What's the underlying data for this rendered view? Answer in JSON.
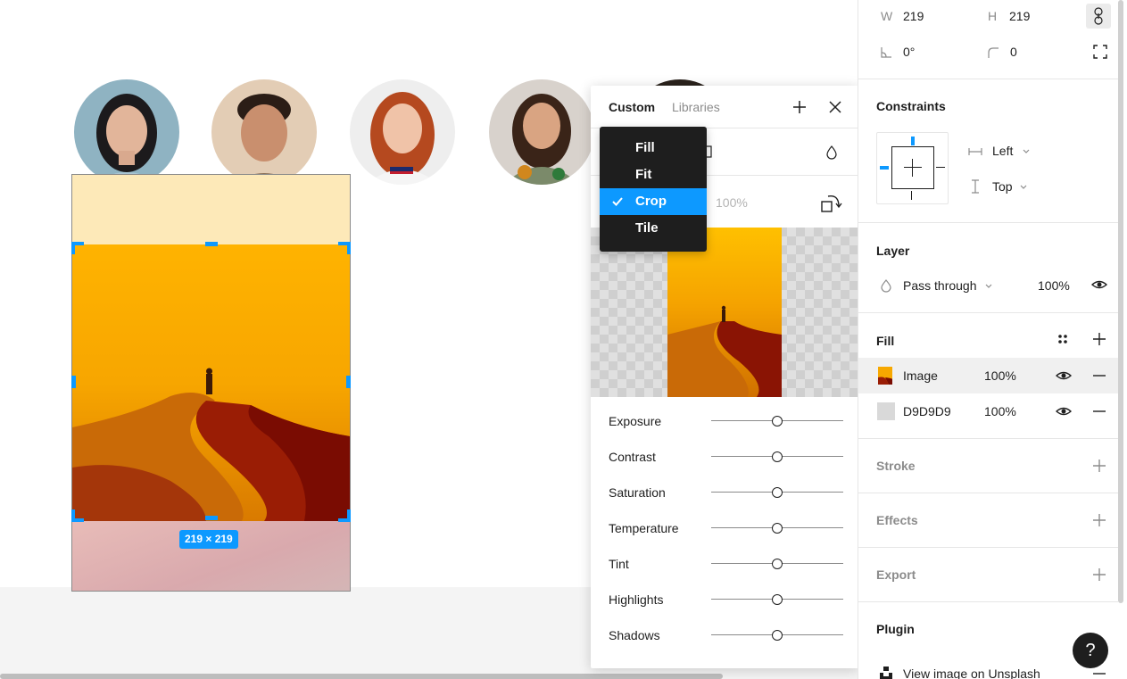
{
  "canvas": {
    "size_badge": "219 × 219"
  },
  "popup": {
    "tabs": [
      {
        "label": "Custom"
      },
      {
        "label": "Libraries"
      }
    ],
    "opacity": "100%",
    "adjustments": [
      {
        "label": "Exposure",
        "value": 0.5
      },
      {
        "label": "Contrast",
        "value": 0.5
      },
      {
        "label": "Saturation",
        "value": 0.5
      },
      {
        "label": "Temperature",
        "value": 0.5
      },
      {
        "label": "Tint",
        "value": 0.5
      },
      {
        "label": "Highlights",
        "value": 0.5
      },
      {
        "label": "Shadows",
        "value": 0.5
      }
    ]
  },
  "dropdown": {
    "items": [
      {
        "label": "Fill"
      },
      {
        "label": "Fit"
      },
      {
        "label": "Crop",
        "selected": true
      },
      {
        "label": "Tile"
      }
    ]
  },
  "panel": {
    "w_label": "W",
    "w_value": "219",
    "h_label": "H",
    "h_value": "219",
    "rotation": "0°",
    "radius": "0",
    "constraints": {
      "title": "Constraints",
      "horizontal": "Left",
      "vertical": "Top"
    },
    "layer": {
      "title": "Layer",
      "blend": "Pass through",
      "opacity": "100%"
    },
    "fill": {
      "title": "Fill",
      "items": [
        {
          "name": "Image",
          "opacity": "100%"
        },
        {
          "name": "D9D9D9",
          "opacity": "100%",
          "color": "#D9D9D9"
        }
      ]
    },
    "stroke": {
      "title": "Stroke"
    },
    "effects": {
      "title": "Effects"
    },
    "export": {
      "title": "Export"
    },
    "plugin": {
      "title": "Plugin",
      "item": "View image on Unsplash"
    },
    "help": "?"
  },
  "colors": {
    "accent": "#0D99FF",
    "dropdown_bg": "#1E1E1E"
  }
}
